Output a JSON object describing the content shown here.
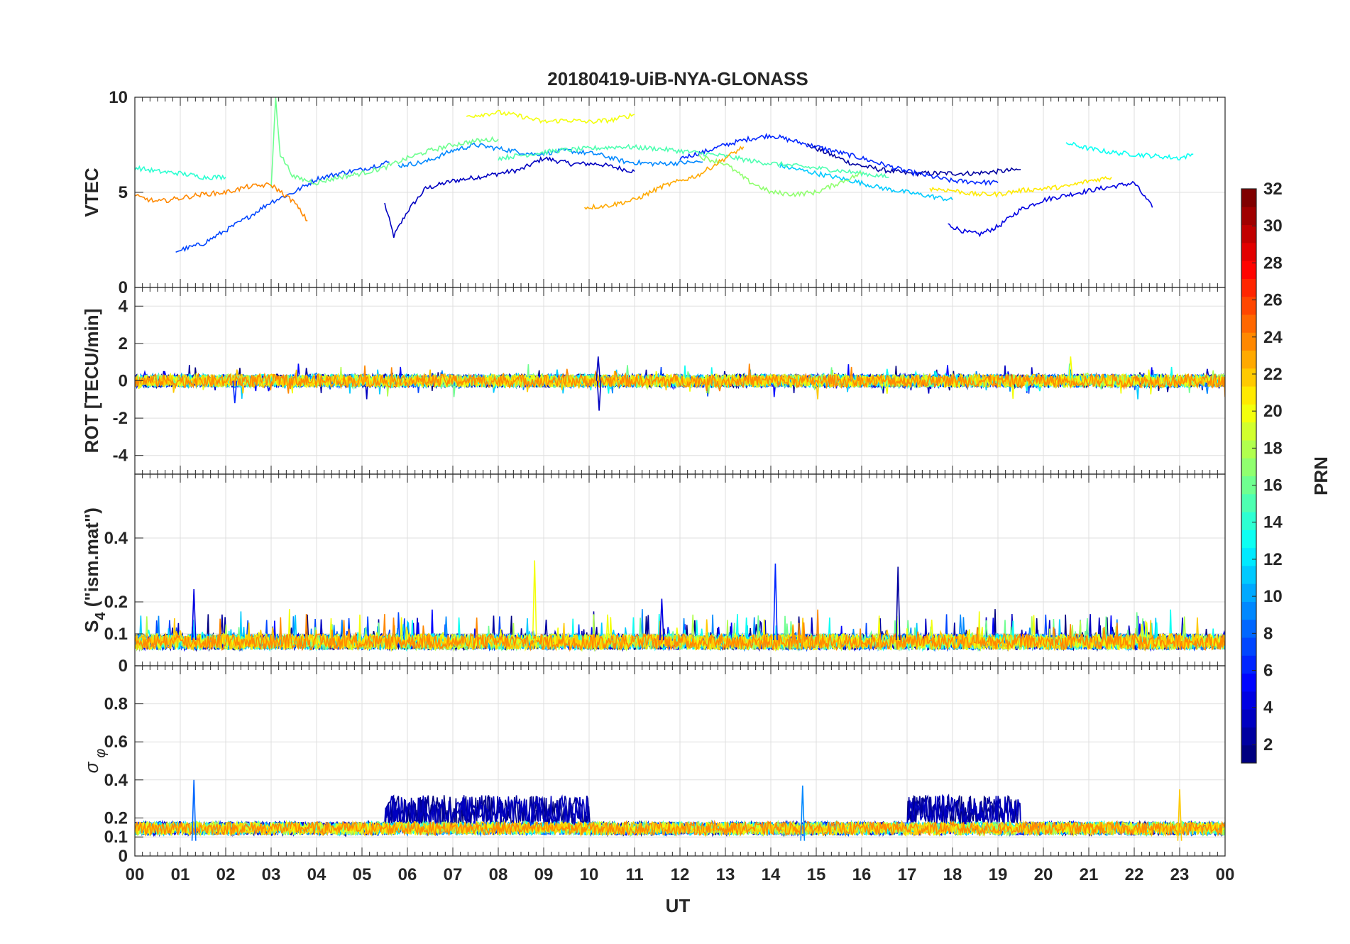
{
  "chart_data": {
    "type": "line",
    "title": "20180419-UiB-NYA-GLONASS",
    "xlabel": "UT",
    "xlim": [
      0,
      24
    ],
    "xticklabels": [
      "00",
      "01",
      "02",
      "03",
      "04",
      "05",
      "06",
      "07",
      "08",
      "09",
      "10",
      "11",
      "12",
      "13",
      "14",
      "15",
      "16",
      "17",
      "18",
      "19",
      "20",
      "21",
      "22",
      "23",
      "00"
    ],
    "grid": true,
    "colorbar": {
      "label": "PRN",
      "range": [
        1,
        32
      ],
      "ticks": [
        2,
        4,
        6,
        8,
        10,
        12,
        14,
        16,
        18,
        20,
        22,
        24,
        26,
        28,
        30,
        32
      ],
      "colormap": "jet",
      "position": "right"
    },
    "panels": [
      {
        "ylabel": "VTEC",
        "ylim": [
          0,
          10
        ],
        "yticks": [
          0,
          5,
          10
        ],
        "series": [
          {
            "prn": 3,
            "x": [
              5.5,
              5.7,
              6.0,
              6.4,
              7.0,
              7.8,
              8.5,
              9.0,
              9.6,
              10.2,
              11.0
            ],
            "y": [
              4.4,
              2.7,
              4.0,
              5.2,
              5.6,
              5.9,
              6.2,
              6.8,
              6.5,
              6.5,
              6.1
            ]
          },
          {
            "prn": 2,
            "x": [
              14.8,
              15.3,
              15.8,
              16.4,
              17.0,
              17.8,
              18.5,
              19.0,
              19.5
            ],
            "y": [
              7.5,
              7.0,
              6.5,
              6.2,
              6.0,
              6.0,
              6.0,
              6.1,
              6.2
            ]
          },
          {
            "prn": 4,
            "x": [
              17.9,
              18.3,
              18.6,
              19.0,
              19.5,
              20.0,
              20.8,
              21.5,
              22.0,
              22.4
            ],
            "y": [
              3.3,
              2.9,
              2.8,
              3.2,
              4.1,
              4.6,
              5.0,
              5.3,
              5.5,
              4.2
            ]
          },
          {
            "prn": 6,
            "x": [
              12.0,
              12.5,
              13.0,
              13.5,
              14.0,
              14.5,
              15.0,
              16.0,
              17.0,
              18.0,
              19.0
            ],
            "y": [
              6.8,
              7.1,
              7.5,
              7.8,
              8.0,
              7.7,
              7.4,
              6.8,
              6.1,
              5.6,
              5.5
            ]
          },
          {
            "prn": 7,
            "x": [
              0.9,
              1.5,
              2.0,
              2.5,
              3.0,
              3.5,
              4.0,
              4.5,
              5.0,
              5.6
            ],
            "y": [
              1.9,
              2.3,
              3.0,
              3.7,
              4.5,
              5.0,
              5.7,
              6.0,
              6.2,
              6.6
            ]
          },
          {
            "prn": 9,
            "x": [
              5.8,
              6.4,
              7.0,
              7.5,
              8.0,
              8.8,
              9.5,
              10.2,
              10.8,
              11.5,
              12.5
            ],
            "y": [
              6.4,
              6.6,
              7.2,
              7.5,
              7.3,
              7.0,
              7.2,
              7.0,
              6.6,
              6.5,
              6.6
            ]
          },
          {
            "prn": 11,
            "x": [
              14.2,
              15.0,
              15.8,
              16.5,
              17.0,
              17.5,
              18.0
            ],
            "y": [
              6.4,
              6.0,
              5.6,
              5.2,
              5.0,
              4.8,
              4.6
            ]
          },
          {
            "prn": 13,
            "x": [
              20.5,
              21.0,
              21.5,
              22.0,
              22.5,
              23.0,
              23.3
            ],
            "y": [
              7.6,
              7.3,
              7.1,
              7.0,
              6.9,
              6.8,
              7.0
            ]
          },
          {
            "prn": 14,
            "x": [
              0.0,
              0.5,
              1.0,
              1.5,
              2.0
            ],
            "y": [
              6.3,
              6.1,
              6.0,
              5.8,
              5.8
            ]
          },
          {
            "prn": 15,
            "x": [
              8.0,
              8.7,
              9.3,
              10.0,
              10.7,
              11.5,
              12.3,
              13.0,
              13.7,
              14.5,
              15.3,
              16.0,
              16.6
            ],
            "y": [
              6.8,
              7.0,
              7.2,
              7.3,
              7.4,
              7.3,
              7.1,
              6.9,
              6.6,
              6.4,
              6.2,
              6.0,
              5.8
            ]
          },
          {
            "prn": 16,
            "x": [
              3.0,
              3.1,
              3.2,
              3.5,
              4.0,
              4.5,
              5.0,
              5.5,
              6.0,
              6.5,
              7.0,
              7.5,
              8.0
            ],
            "y": [
              5.2,
              10.0,
              7.0,
              5.8,
              5.5,
              5.8,
              6.0,
              6.3,
              6.8,
              7.2,
              7.5,
              7.7,
              7.8
            ]
          },
          {
            "prn": 17,
            "x": [
              12.4,
              13.0,
              13.5,
              14.0,
              14.5,
              15.0,
              15.5,
              16.0
            ],
            "y": [
              6.9,
              6.5,
              5.6,
              5.0,
              4.9,
              5.0,
              5.5,
              6.0
            ]
          },
          {
            "prn": 20,
            "x": [
              7.3,
              8.0,
              8.5,
              9.0,
              9.5,
              10.0,
              10.5,
              11.0
            ],
            "y": [
              9.0,
              9.2,
              9.0,
              8.7,
              8.8,
              8.7,
              8.8,
              9.1
            ]
          },
          {
            "prn": 21,
            "x": [
              17.5,
              18.0,
              18.5,
              19.0,
              19.5,
              20.0,
              20.5,
              21.0,
              21.5
            ],
            "y": [
              5.2,
              5.1,
              4.9,
              4.9,
              5.1,
              5.2,
              5.3,
              5.6,
              5.8
            ]
          },
          {
            "prn": 23,
            "x": [
              9.9,
              10.4,
              11.0,
              11.6,
              12.0,
              12.4,
              13.0,
              13.4
            ],
            "y": [
              4.2,
              4.3,
              4.6,
              5.3,
              5.6,
              5.9,
              6.8,
              7.4
            ]
          },
          {
            "prn": 24,
            "x": [
              0.0,
              0.5,
              1.0,
              1.5,
              2.0,
              2.5,
              3.0,
              3.5,
              3.8
            ],
            "y": [
              4.8,
              4.5,
              4.7,
              4.9,
              5.0,
              5.3,
              5.4,
              4.5,
              3.5
            ]
          }
        ]
      },
      {
        "ylabel": "ROT [TECU/min]",
        "ylim": [
          -5,
          5
        ],
        "yticks": [
          -4,
          -2,
          0,
          2,
          4
        ],
        "note": "all PRNs fluctuate within about ±0.5 around 0; spikes near 10.2 UT (+1.3, -1.6) and 20.6 UT (+1.3)"
      },
      {
        "ylabel": "S4 (\"ism.mat\")",
        "ylabel_parts": {
          "base": "S",
          "sub": "4",
          "rest": " (\"ism.mat\")"
        },
        "ylim": [
          0,
          0.6
        ],
        "yticks": [
          0,
          0.1,
          0.2,
          0.4
        ],
        "note": "background about 0.05–0.12 for all PRNs; peaks: 0.24 at 1.3 UT, 0.33 at 8.8 UT, 0.31 at 16.8 UT, 0.32 at 14.1 UT"
      },
      {
        "ylabel": "σ φ",
        "ylabel_parts": {
          "base": "σ",
          "sub": "φ"
        },
        "ylim": [
          0,
          1
        ],
        "yticks": [
          0,
          0.1,
          0.2,
          0.4,
          0.6,
          0.8
        ],
        "note": "background about 0.10–0.20; PRN 1–3 elevated 0.2–0.38 between 5.5–10 UT and 17–19.5 UT; spikes 0.4 at 1.3 UT and 0.37 at 14.7 UT"
      }
    ]
  }
}
